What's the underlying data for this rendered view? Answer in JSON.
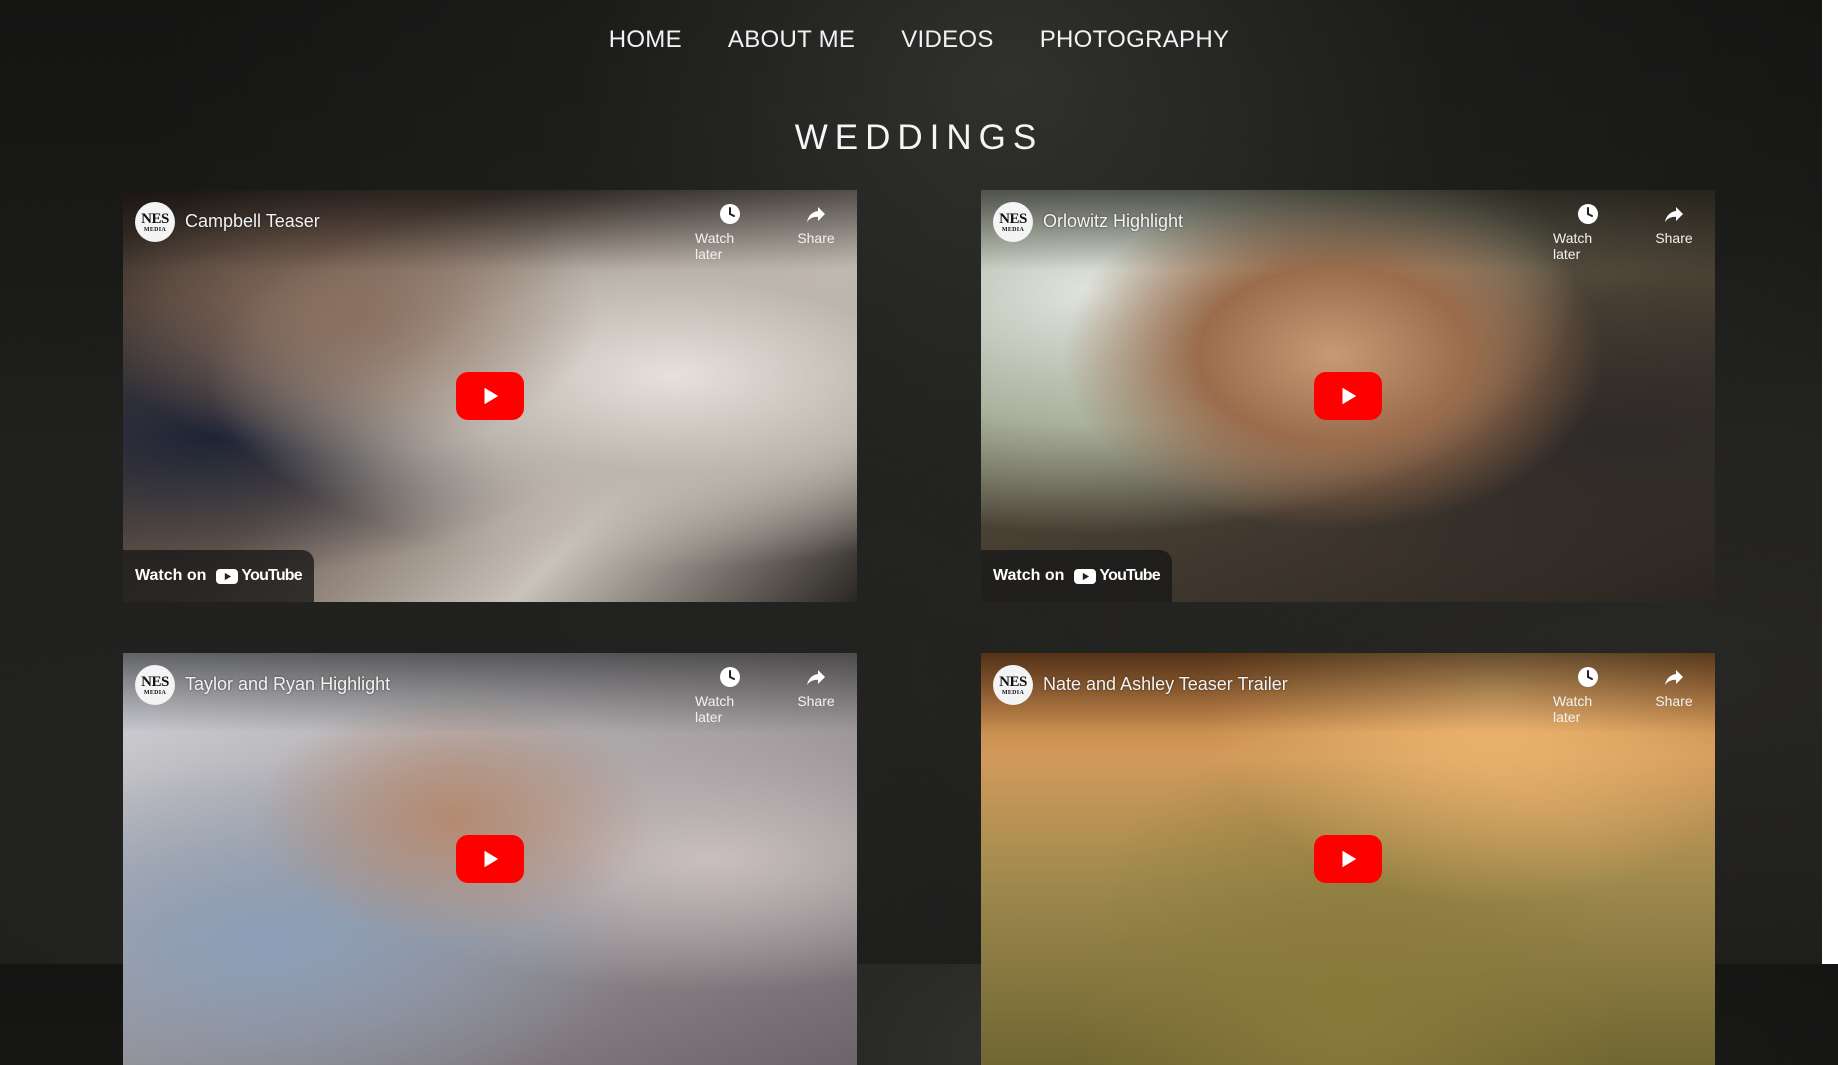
{
  "nav": {
    "items": [
      {
        "label": "HOME"
      },
      {
        "label": "ABOUT ME"
      },
      {
        "label": "VIDEOS"
      },
      {
        "label": "PHOTOGRAPHY"
      }
    ]
  },
  "section": {
    "title": "WEDDINGS"
  },
  "videos": [
    {
      "title": "Campbell Teaser",
      "channel_mark": "NES",
      "channel_sub": "MEDIA",
      "watch_later": "Watch later",
      "share": "Share",
      "watch_on": "Watch on",
      "youtube": "YouTube",
      "show_watch_on": true
    },
    {
      "title": "Orlowitz Highlight",
      "channel_mark": "NES",
      "channel_sub": "MEDIA",
      "watch_later": "Watch later",
      "share": "Share",
      "watch_on": "Watch on",
      "youtube": "YouTube",
      "show_watch_on": true
    },
    {
      "title": "Taylor and Ryan Highlight",
      "channel_mark": "NES",
      "channel_sub": "MEDIA",
      "watch_later": "Watch later",
      "share": "Share"
    },
    {
      "title": "Nate and Ashley Teaser Trailer",
      "channel_mark": "NES",
      "channel_sub": "MEDIA",
      "watch_later": "Watch later",
      "share": "Share"
    }
  ],
  "colors": {
    "background": "#1a1a19",
    "play_button": "#ff0000",
    "text": "#f2f2f2"
  },
  "icons": {
    "watch_later": "clock-icon",
    "share": "share-arrow-icon",
    "play": "play-icon",
    "youtube": "youtube-logo-icon"
  }
}
